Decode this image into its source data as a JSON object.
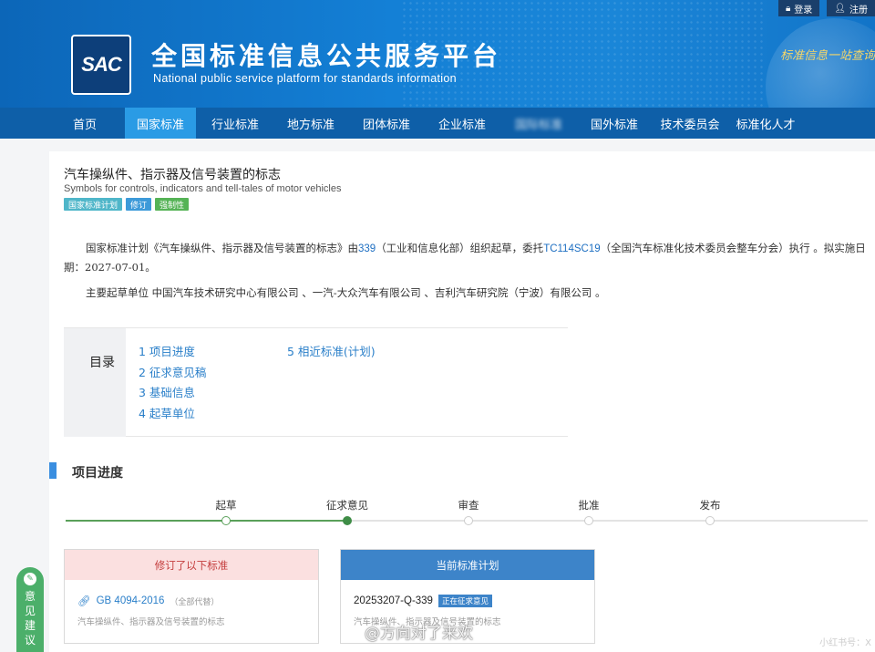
{
  "header": {
    "login": "登录",
    "register": "注册",
    "logo": "SAC",
    "title": "全国标准信息公共服务平台",
    "subtitle": "National public service platform  for standards information",
    "slogan": "标准信息一站查询"
  },
  "nav": {
    "items": [
      "首页",
      "国家标准",
      "行业标准",
      "地方标准",
      "团体标准",
      "企业标准",
      "国际标准",
      "国外标准",
      "技术委员会",
      "标准化人才"
    ],
    "active_index": 1
  },
  "doc": {
    "title": "汽车操纵件、指示器及信号装置的标志",
    "title_en": "Symbols for controls, indicators and tell-tales of motor vehicles",
    "tags": [
      {
        "label": "国家标准计划",
        "color": "#4fb6c9"
      },
      {
        "label": "修订",
        "color": "#3d9ad9"
      },
      {
        "label": "强制性",
        "color": "#55b356"
      }
    ],
    "para1_a": "国家标准计划《汽车操纵件、指示器及信号装置的标志》由",
    "para1_link1": "339",
    "para1_b": "（工业和信息化部）组织起草，委托",
    "para1_link2": "TC114SC19",
    "para1_c": "（全国汽车标准化技术委员会整车分会）执行 。拟实施日期：2027-07-01。",
    "para2": "主要起草单位 中国汽车技术研究中心有限公司 、一汽-大众汽车有限公司 、吉利汽车研究院（宁波）有限公司 。"
  },
  "toc": {
    "label": "目录",
    "items": [
      "1 项目进度",
      "2 征求意见稿",
      "3 基础信息",
      "4 起草单位",
      "5 相近标准(计划)"
    ]
  },
  "progress": {
    "section_title": "项目进度",
    "steps": [
      "起草",
      "征求意见",
      "审查",
      "批准",
      "发布"
    ],
    "current_index": 1
  },
  "cards": {
    "revised": {
      "header": "修订了以下标准",
      "code": "GB 4094-2016",
      "note": "（全部代替）",
      "desc": "汽车操纵件、指示器及信号装置的标志"
    },
    "current": {
      "header": "当前标准计划",
      "code": "20253207-Q-339",
      "status": "正在征求意见",
      "desc": "汽车操纵件、指示器及信号装置的标志"
    }
  },
  "feedback": {
    "chars": [
      "意",
      "见",
      "建",
      "议"
    ]
  },
  "watermark": {
    "text": "@方向对了来欢",
    "right_text": "小红书号：X"
  },
  "colors": {
    "header_blue": "#1480d6",
    "nav_blue": "#0e5fa8",
    "nav_active": "#2a9be5",
    "link": "#2a7fc9",
    "progress_done": "#3f8d47",
    "feedback_green": "#4caf6a"
  }
}
